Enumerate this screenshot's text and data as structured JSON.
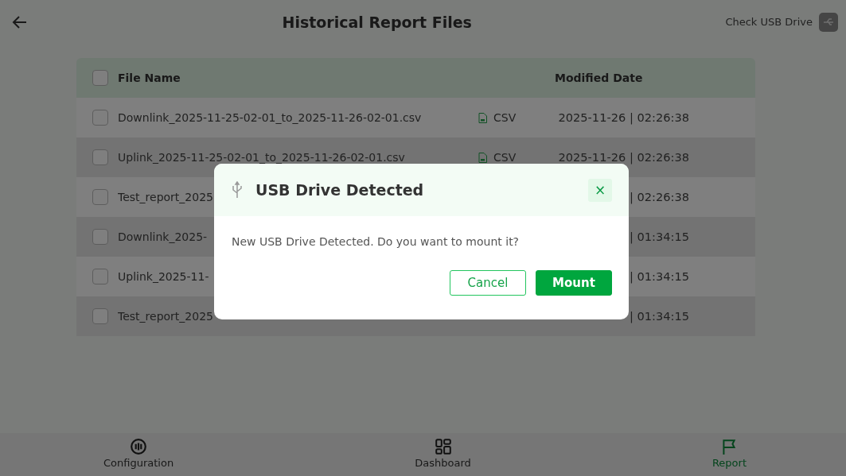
{
  "header": {
    "title": "Historical Report Files",
    "usb_button": "Check USB Drive"
  },
  "table": {
    "columns": [
      "File Name",
      "Modified Date"
    ],
    "select_all": {
      "checked": false
    },
    "rows": [
      {
        "name": "Downlink_2025-11-25-02-01_to_2025-11-26-02-01.csv",
        "type": "CSV",
        "kind": "csv",
        "date": "2025-11-26 | 02:26:38",
        "checked": false
      },
      {
        "name": "Uplink_2025-11-25-02-01_to_2025-11-26-02-01.csv",
        "type": "CSV",
        "kind": "csv",
        "date": "2025-11-26 | 02:26:38",
        "checked": false
      },
      {
        "name": "Test_report_2025",
        "date": "| 02:26:38",
        "checked": false
      },
      {
        "name": "Downlink_2025-",
        "date": "| 01:34:15",
        "checked": false
      },
      {
        "name": "Uplink_2025-11-",
        "date": "| 01:34:15",
        "checked": false
      },
      {
        "name": "Test_report_2025",
        "date": "| 01:34:15",
        "checked": false
      }
    ]
  },
  "nav": [
    {
      "label": "Configuration",
      "kind": "config",
      "selected": false
    },
    {
      "label": "Dashboard",
      "kind": "dashboard",
      "selected": false
    },
    {
      "label": "Report",
      "kind": "report",
      "selected": true
    }
  ],
  "modal": {
    "title": "USB Drive Detected",
    "message": "New USB Drive Detected. Do you want to mount it?",
    "close": "×",
    "buttons": [
      {
        "label": "Cancel",
        "kind": "secondary"
      },
      {
        "label": "Mount",
        "kind": "primary"
      }
    ]
  }
}
